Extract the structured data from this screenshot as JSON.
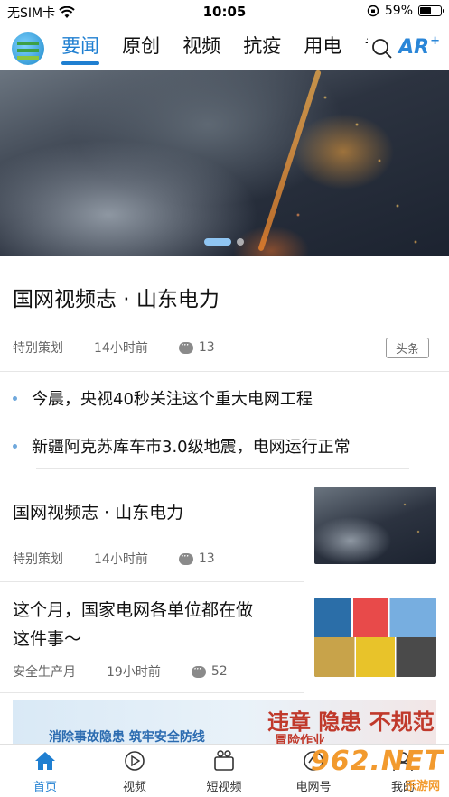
{
  "status_bar": {
    "carrier": "无SIM卡",
    "time": "10:05",
    "battery": "59%",
    "battery_level": 0.59
  },
  "nav": {
    "tabs": [
      {
        "label": "要闻",
        "active": true
      },
      {
        "label": "原创",
        "active": false
      },
      {
        "label": "视频",
        "active": false
      },
      {
        "label": "抗疫",
        "active": false
      },
      {
        "label": "用电",
        "active": false
      },
      {
        "label": "专",
        "active": false
      }
    ],
    "ar_label": "AR",
    "ar_plus": "+"
  },
  "headline": {
    "title": "国网视频志 · 山东电力",
    "category": "特别策划",
    "time": "14小时前",
    "comments": "13",
    "tag": "头条"
  },
  "bullets": [
    "今晨，央视40秒关注这个重大电网工程",
    "新疆阿克苏库车市3.0级地震，电网运行正常"
  ],
  "news": [
    {
      "title": "国网视频志 · 山东电力",
      "category": "特别策划",
      "time": "14小时前",
      "comments": "13"
    },
    {
      "title_line1": "这个月，国家电网各单位都在做",
      "title_line2": "这件事～",
      "category": "安全生产月",
      "time": "19小时前",
      "comments": "52"
    }
  ],
  "banner": {
    "left_text": "消除事故隐患  筑牢安全防线",
    "right_text": "违章 隐患 不规范",
    "right_text2": "冒险作业"
  },
  "tab_bar": [
    {
      "label": "首页",
      "icon": "home-icon",
      "active": true
    },
    {
      "label": "视频",
      "icon": "play-icon",
      "active": false
    },
    {
      "label": "短视频",
      "icon": "camera-icon",
      "active": false
    },
    {
      "label": "电网号",
      "icon": "grid-account-icon",
      "active": false
    },
    {
      "label": "我的",
      "icon": "profile-icon",
      "active": false
    }
  ],
  "watermark": {
    "text": "962.NET",
    "sub": "乐游网"
  },
  "colors": {
    "accent": "#1f7fd1",
    "bullet": "#6fa8dc",
    "meta": "#666666"
  }
}
